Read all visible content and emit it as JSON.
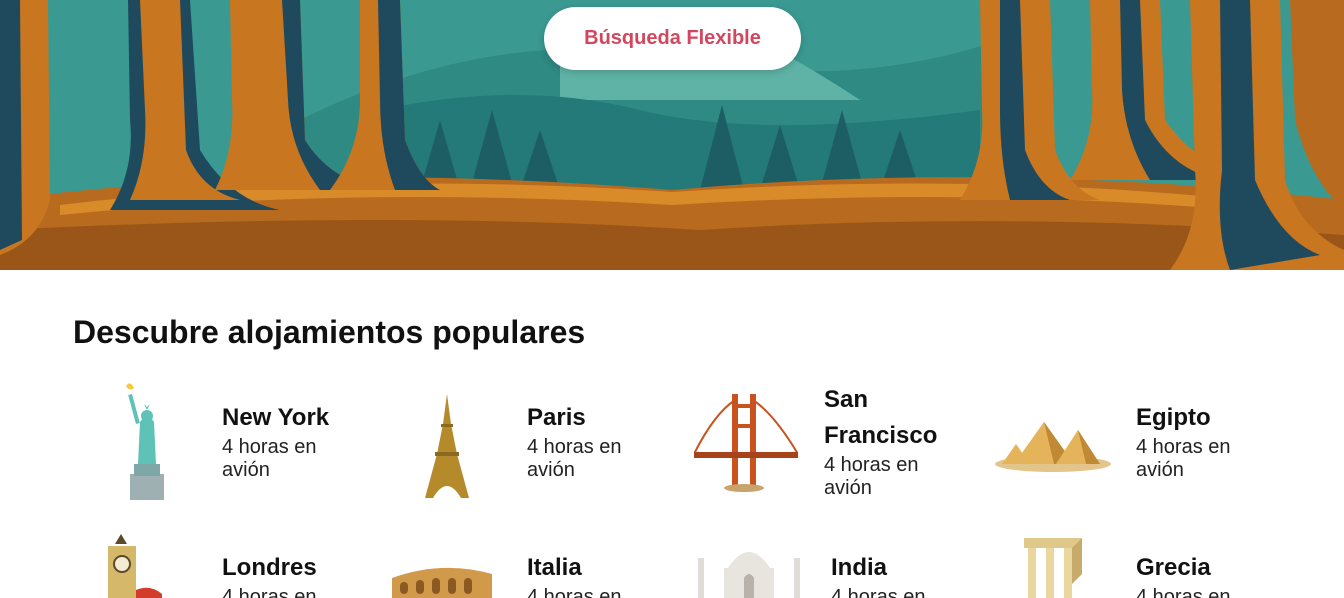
{
  "hero": {
    "button_label": "Búsqueda Flexible"
  },
  "popular": {
    "title": "Descubre alojamientos populares",
    "destinations": [
      {
        "name": "New York",
        "subtitle": "4 horas en avión",
        "icon": "statue-of-liberty-icon"
      },
      {
        "name": "Paris",
        "subtitle": "4 horas en avión",
        "icon": "eiffel-tower-icon"
      },
      {
        "name": "San Francisco",
        "subtitle": "4 horas en avión",
        "icon": "golden-gate-bridge-icon"
      },
      {
        "name": "Egipto",
        "subtitle": "4 horas en avión",
        "icon": "pyramids-icon"
      },
      {
        "name": "Londres",
        "subtitle": "4 horas en",
        "icon": "big-ben-icon"
      },
      {
        "name": "Italia",
        "subtitle": "4 horas en",
        "icon": "colosseum-icon"
      },
      {
        "name": "India",
        "subtitle": "4 horas en",
        "icon": "taj-mahal-icon"
      },
      {
        "name": "Grecia",
        "subtitle": "4 horas en",
        "icon": "greek-temple-icon"
      }
    ]
  },
  "colors": {
    "accent": "#d2475e",
    "forest_teal": "#2d8a86",
    "tree_orange": "#c8761f",
    "tree_shadow": "#1f4a5e"
  }
}
